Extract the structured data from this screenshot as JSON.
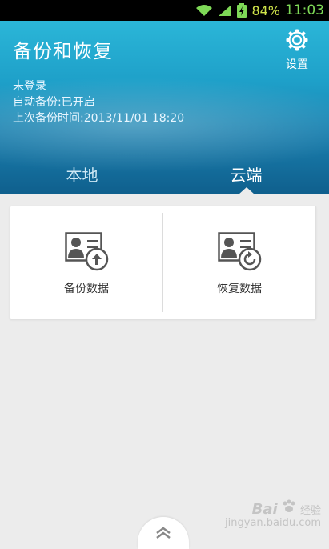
{
  "status_bar": {
    "battery": "84%",
    "time": "11:03",
    "icons": [
      "wifi-icon",
      "signal-icon",
      "battery-icon"
    ]
  },
  "header": {
    "title": "备份和恢复",
    "settings_label": "设置",
    "login_status": "未登录",
    "auto_backup": "自动备份:已开启",
    "last_backup": "上次备份时间:2013/11/01 18:20"
  },
  "tabs": [
    {
      "label": "本地",
      "selected": false
    },
    {
      "label": "云端",
      "selected": true
    }
  ],
  "card": {
    "backup_label": "备份数据",
    "restore_label": "恢复数据"
  },
  "watermark": {
    "main": "Bai",
    "sub1": "经验",
    "sub2": "jingyan.baidu.com"
  },
  "colors": {
    "header_top": "#2bb6d8",
    "header_bottom": "#0f5f8d",
    "background": "#ececec"
  }
}
